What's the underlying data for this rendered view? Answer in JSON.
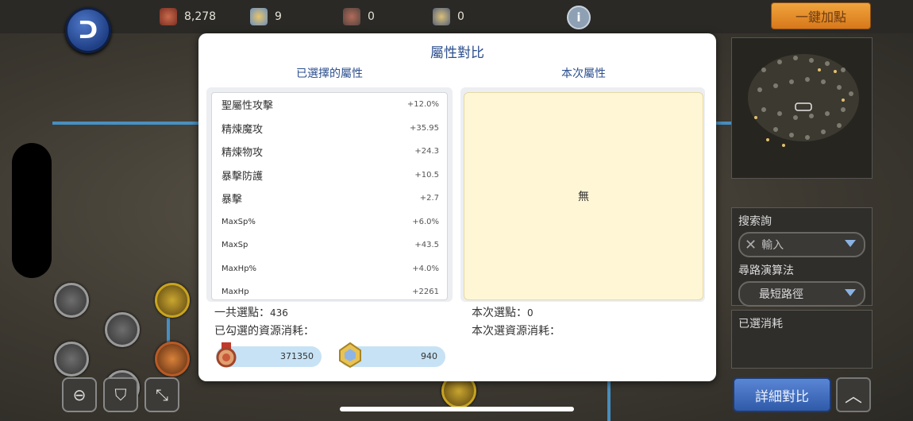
{
  "topbar": {
    "resources": [
      {
        "icon": "medal-icon",
        "value": "8,278"
      },
      {
        "icon": "gem-icon",
        "value": "9"
      },
      {
        "icon": "locked-medal-icon",
        "value": "0"
      },
      {
        "icon": "locked-gem-icon",
        "value": "0"
      }
    ],
    "info_glyph": "i",
    "onekey_label": "一鍵加點"
  },
  "dialog": {
    "title": "屬性對比",
    "left_header": "已選擇的屬性",
    "right_header": "本次屬性",
    "attributes": [
      {
        "name": "聖屬性攻擊",
        "value": "+12.0%"
      },
      {
        "name": "精煉魔攻",
        "value": "+35.95"
      },
      {
        "name": "精煉物攻",
        "value": "+24.3"
      },
      {
        "name": "暴擊防護",
        "value": "+10.5"
      },
      {
        "name": "暴擊",
        "value": "+2.7"
      },
      {
        "name": "MaxSp%",
        "value": "+6.0%"
      },
      {
        "name": "MaxSp",
        "value": "+43.5"
      },
      {
        "name": "MaxHp%",
        "value": "+4.0%"
      },
      {
        "name": "MaxHp",
        "value": "+2261"
      }
    ],
    "right_empty": "無",
    "total_points_label": "一共選點：",
    "total_points_value": "436",
    "checked_cost_label": "已勾選的資源消耗：",
    "current_points_label": "本次選點：",
    "current_points_value": "0",
    "current_cost_label": "本次選資源消耗：",
    "costs": [
      {
        "icon": "medal-icon",
        "value": "371350"
      },
      {
        "icon": "gem-icon",
        "value": "940"
      }
    ]
  },
  "sidebar": {
    "search_label": "搜索詢",
    "search_placeholder": "輸入",
    "path_label": "尋路演算法",
    "path_value": "最短路徑",
    "selected_cost_label": "已選消耗"
  },
  "buttons": {
    "detail_compare": "詳細對比",
    "up_glyph": "︿"
  },
  "colors": {
    "accent_blue": "#2c4f8f",
    "onekey_orange": "#e08a25",
    "cost_pill": "#c7e2f4",
    "empty_panel": "#fff6d6"
  }
}
